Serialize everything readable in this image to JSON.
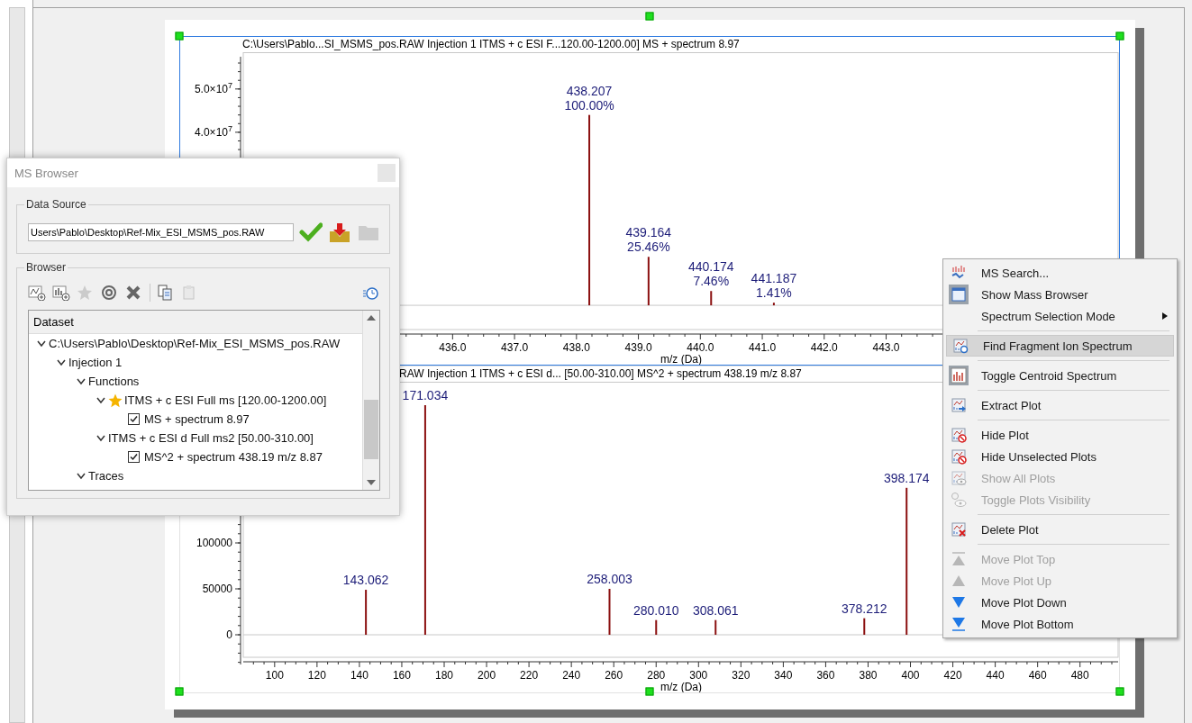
{
  "plots": [
    {
      "selected": true,
      "title": "C:\\Users\\Pablo...SI_MSMS_pos.RAW Injection 1 ITMS + c ESI F...120.00-1200.00] MS + spectrum 8.97",
      "chart_data": {
        "type": "bar",
        "xlabel": "m/z (Da)",
        "x": [
          438.207,
          439.164,
          440.174,
          441.187
        ],
        "values": [
          44000000,
          11200000,
          3300000,
          600000
        ],
        "xlim": [
          432.62,
          446.76
        ],
        "ylim": [
          -5600000,
          58500000
        ],
        "xticks": [
          {
            "value": 436,
            "label": "436.0"
          },
          {
            "value": 437,
            "label": "437.0"
          },
          {
            "value": 438,
            "label": "438.0"
          },
          {
            "value": 439,
            "label": "439.0"
          },
          {
            "value": 440,
            "label": "440.0"
          },
          {
            "value": 441,
            "label": "441.0"
          },
          {
            "value": 442,
            "label": "442.0"
          },
          {
            "value": 443,
            "label": "443.0"
          }
        ],
        "yticks": [
          {
            "value": 40000000,
            "label": "4.0×10$^{7}$"
          },
          {
            "value": 50000000,
            "label": "5.0×10$^{7}$"
          }
        ]
      },
      "peak_labels": [
        [
          "438.207",
          "100.00%"
        ],
        [
          "439.164",
          "25.46%"
        ],
        [
          "440.174",
          "7.46%"
        ],
        [
          "441.187",
          "1.41%"
        ]
      ]
    },
    {
      "selected": false,
      "title": "RAW Injection 1 ITMS + c ESI d... [50.00-310.00] MS^2 + spectrum 438.19 m/z 8.87",
      "chart_data": {
        "type": "bar",
        "xlabel": "m/z (Da)",
        "x": [
          143.062,
          171.034,
          258.003,
          280.01,
          308.061,
          378.212,
          398.174
        ],
        "values": [
          49000,
          250000,
          50000,
          16000,
          16000,
          18000,
          160000
        ],
        "xlim": [
          85.2,
          498.4
        ],
        "ylim": [
          -24500,
          275500
        ],
        "xticks": [
          100,
          120,
          140,
          160,
          180,
          200,
          220,
          240,
          260,
          280,
          300,
          320,
          340,
          360,
          380,
          400,
          420,
          440,
          460,
          480
        ],
        "yticks": [
          0,
          50000,
          100000
        ]
      },
      "peak_labels": [
        [
          "143.062"
        ],
        [
          "171.034"
        ],
        [
          "258.003"
        ],
        [
          "280.010"
        ],
        [
          "308.061"
        ],
        [
          "378.212"
        ],
        [
          "398.174"
        ]
      ]
    }
  ],
  "ms_browser": {
    "title": "MS Browser",
    "data_source": {
      "label": "Data Source",
      "path": "Users\\Pablo\\Desktop\\Ref-Mix_ESI_MSMS_pos.RAW",
      "actions": [
        {
          "disabled": false
        },
        {
          "disabled": false
        },
        {
          "disabled": true
        }
      ]
    },
    "browser": {
      "label": "Browser",
      "toolbar": [
        {
          "disabled": false
        },
        {
          "disabled": false
        },
        {
          "disabled": true
        },
        {
          "disabled": false
        },
        {
          "disabled": false
        },
        {
          "disabled": false
        },
        {
          "disabled": true
        },
        {
          "disabled": false
        }
      ],
      "column": "Dataset",
      "tree": [
        {
          "label": "C:\\Users\\Pablo\\Desktop\\Ref-Mix_ESI_MSMS_pos.RAW",
          "expanded": true,
          "children": [
            {
              "label": "Injection 1",
              "expanded": true,
              "children": [
                {
                  "label": "Functions",
                  "expanded": true,
                  "children": [
                    {
                      "label": "ITMS + c ESI Full ms [120.00-1200.00]",
                      "expanded": true,
                      "starred": true,
                      "children": [
                        {
                          "label": "MS + spectrum 8.97",
                          "checked": true
                        }
                      ]
                    },
                    {
                      "label": "ITMS + c ESI d Full ms2 [50.00-310.00]",
                      "expanded": true,
                      "starred": false,
                      "children": [
                        {
                          "label": "MS^2 + spectrum 438.19 m/z 8.87",
                          "checked": true
                        }
                      ]
                    }
                  ]
                },
                {
                  "label": "Traces",
                  "expanded": true
                }
              ]
            }
          ]
        }
      ]
    }
  },
  "context_menu": [
    {
      "kind": "item",
      "label": "MS Search...",
      "checked": false,
      "disabled": false,
      "selected": false,
      "submenu": false
    },
    {
      "kind": "item",
      "label": "Show Mass Browser",
      "checked": true,
      "disabled": false,
      "selected": false,
      "submenu": false
    },
    {
      "kind": "item",
      "label": "Spectrum Selection Mode",
      "checked": false,
      "disabled": false,
      "selected": false,
      "submenu": true
    },
    {
      "kind": "separator"
    },
    {
      "kind": "item",
      "label": "Find Fragment Ion Spectrum",
      "checked": false,
      "disabled": false,
      "selected": true,
      "submenu": false
    },
    {
      "kind": "separator"
    },
    {
      "kind": "item",
      "label": "Toggle Centroid Spectrum",
      "checked": true,
      "disabled": false,
      "selected": false,
      "submenu": false
    },
    {
      "kind": "separator"
    },
    {
      "kind": "item",
      "label": "Extract Plot",
      "checked": false,
      "disabled": false,
      "selected": false,
      "submenu": false
    },
    {
      "kind": "separator"
    },
    {
      "kind": "item",
      "label": "Hide Plot",
      "checked": false,
      "disabled": false,
      "selected": false,
      "submenu": false
    },
    {
      "kind": "item",
      "label": "Hide Unselected Plots",
      "checked": false,
      "disabled": false,
      "selected": false,
      "submenu": false
    },
    {
      "kind": "item",
      "label": "Show All Plots",
      "checked": false,
      "disabled": true,
      "selected": false,
      "submenu": false
    },
    {
      "kind": "item",
      "label": "Toggle Plots Visibility",
      "checked": false,
      "disabled": true,
      "selected": false,
      "submenu": false
    },
    {
      "kind": "separator"
    },
    {
      "kind": "item",
      "label": "Delete Plot",
      "checked": false,
      "disabled": false,
      "selected": false,
      "submenu": false
    },
    {
      "kind": "separator"
    },
    {
      "kind": "item",
      "label": "Move Plot Top",
      "checked": false,
      "disabled": true,
      "selected": false,
      "submenu": false
    },
    {
      "kind": "item",
      "label": "Move Plot Up",
      "checked": false,
      "disabled": true,
      "selected": false,
      "submenu": false
    },
    {
      "kind": "item",
      "label": "Move Plot Down",
      "checked": false,
      "disabled": false,
      "selected": false,
      "submenu": false
    },
    {
      "kind": "item",
      "label": "Move Plot Bottom",
      "checked": false,
      "disabled": false,
      "selected": false,
      "submenu": false
    }
  ]
}
